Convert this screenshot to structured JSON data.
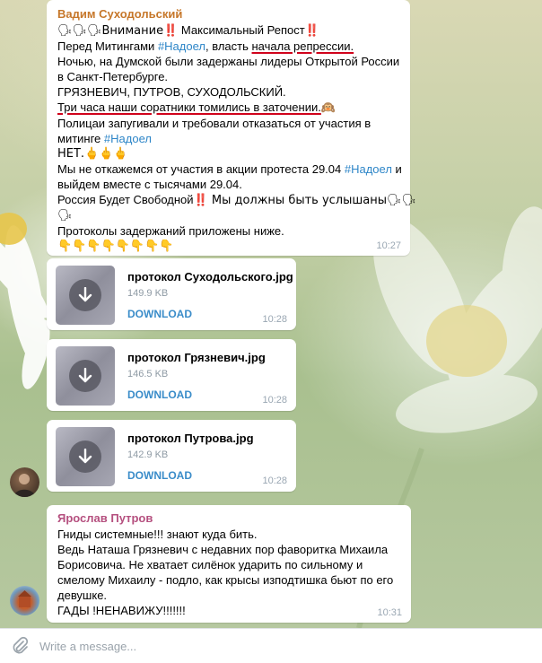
{
  "message1": {
    "sender": "Вадим Суходольский",
    "lines": {
      "l1_prefix": "🗣🗣🗣Внимание",
      "l1_bang": "‼️",
      "l1_mid": " Максимальный Репост",
      "l1_bang2": "‼️",
      "l2_a": "Перед Митингами ",
      "l2_tag": "#Надоел",
      "l2_b": ", власть ",
      "l2_ul": "начала репрессии.",
      "l3": "Ночью, на Думской были задержаны лидеры Открытой России",
      "l4": "в Санкт-Петербурге.",
      "l5": "ГРЯЗНЕВИЧ, ПУТРОВ, СУХОДОЛЬСКИЙ.",
      "l6_ul": "Три часа наши соратники томились в заточении.",
      "l6_emoji": "🙉",
      "l7": "Полицаи запугивали и требовали отказаться от участия в",
      "l8_a": "митинге ",
      "l8_tag": "#Надоел",
      "l9": "НЕТ.🖕🖕🖕",
      "l10_a": "Мы не откажемся от участия в акции протеста 29.04 ",
      "l10_tag": "#Надоел",
      "l10_b": " и",
      "l11": "выйдем вместе с тысячами  29.04.",
      "l12_a": "Россия Будет Свободной",
      "l12_bang": "‼️",
      "l12_b": " Мы должны быть услышаны🗣🗣",
      "l13": "🗣",
      "l14": "Протоколы задержаний приложены ниже.",
      "l15": "👇👇👇👇👇👇👇👇"
    },
    "time": "10:27"
  },
  "files": [
    {
      "name": "протокол Суходольского.jpg",
      "size": "149.9 KB",
      "action": "DOWNLOAD",
      "time": "10:28"
    },
    {
      "name": "протокол Грязневич.jpg",
      "size": "146.5 KB",
      "action": "DOWNLOAD",
      "time": "10:28"
    },
    {
      "name": "протокол Путрова.jpg",
      "size": "142.9 KB",
      "action": "DOWNLOAD",
      "time": "10:28"
    }
  ],
  "message3": {
    "sender": "Ярослав Путров",
    "lines": {
      "l1": "Гниды системные!!! знают куда бить.",
      "l2": "Ведь Наташа Грязневич с недавних пор фаворитка Михаила",
      "l3": "Борисовича. Не хватает силёнок ударить по сильному и",
      "l4": "смелому Михаилу - подло, как крысы изподтишка бьют по его",
      "l5": "девушке.",
      "l6": "ГАДЫ !НЕНАВИЖУ!!!!!!!"
    },
    "time": "10:31"
  },
  "composer": {
    "placeholder": "Write a message..."
  },
  "colors": {
    "sender1": "#c6772a",
    "sender2": "#b5507f",
    "hashtag": "#2e86c8",
    "download": "#3a8cc9",
    "underline": "#d0021b"
  },
  "icons": {
    "attach": "paperclip-icon",
    "download": "download-arrow-icon"
  }
}
